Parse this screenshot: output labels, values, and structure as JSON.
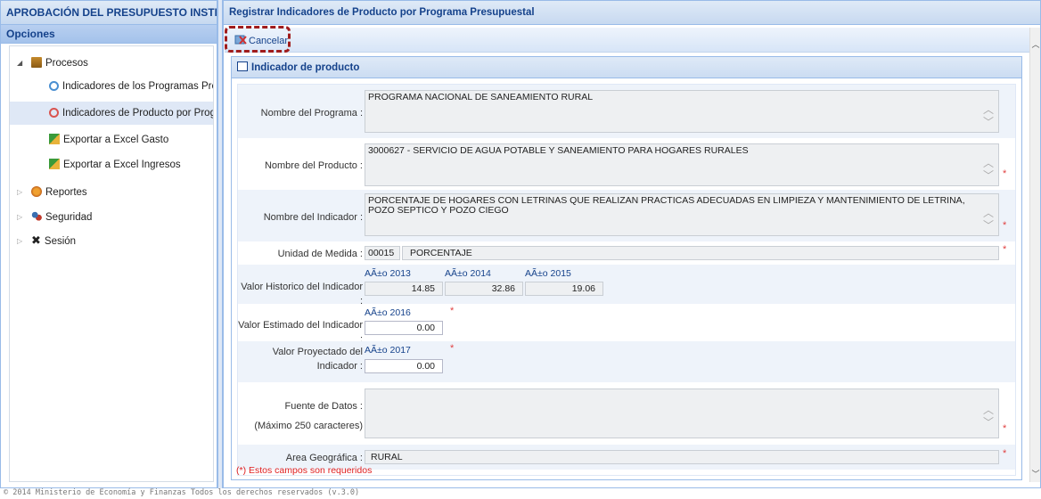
{
  "left_panel": {
    "title": "APROBACIÓN DEL PRESUPUESTO INSTITUCIONA",
    "subtitle": "Opciones",
    "tree": {
      "procesos": "Procesos",
      "indicadores_programas": "Indicadores de los Programas Presupue",
      "indicadores_producto": "Indicadores de Producto por Programa",
      "exportar_gasto": "Exportar a Excel Gasto",
      "exportar_ingresos": "Exportar a Excel Ingresos",
      "reportes": "Reportes",
      "seguridad": "Seguridad",
      "sesion": "Sesión"
    }
  },
  "right_panel": {
    "title": "Registrar Indicadores de Producto por Programa Presupuestal",
    "toolbar": {
      "cancel_label": "Cancelar"
    },
    "fieldset_title": "Indicador de producto",
    "form": {
      "programa_label": "Nombre del Programa :",
      "programa_value": "PROGRAMA NACIONAL DE SANEAMIENTO RURAL",
      "producto_label": "Nombre del Producto :",
      "producto_value": "3000627 - SERVICIO DE AGUA POTABLE Y SANEAMIENTO PARA HOGARES RURALES",
      "indicador_label": "Nombre del Indicador :",
      "indicador_value": "PORCENTAJE DE HOGARES CON LETRINAS QUE REALIZAN PRACTICAS ADECUADAS EN LIMPIEZA Y MANTENIMIENTO DE LETRINA, POZO SEPTICO Y POZO CIEGO",
      "unidad_label": "Unidad de Medida :",
      "unidad_code": "00015",
      "unidad_name": "PORCENTAJE",
      "historico_label": "Valor Historico del Indicador :",
      "historico": [
        {
          "year": "AÃ±o 2013",
          "value": "14.85"
        },
        {
          "year": "AÃ±o 2014",
          "value": "32.86"
        },
        {
          "year": "AÃ±o 2015",
          "value": "19.06"
        }
      ],
      "estimado_label": "Valor Estimado del Indicador :",
      "estimado_year": "AÃ±o 2016",
      "estimado_value": "0.00",
      "proyectado_label_1": "Valor Proyectado del",
      "proyectado_label_2": "Indicador :",
      "proyectado_year": "AÃ±o 2017",
      "proyectado_value": "0.00",
      "fuente_label_1": "Fuente de Datos :",
      "fuente_label_2": "(Máximo 250 caracteres)",
      "fuente_value": "",
      "area_label": "Area Geográfica :",
      "area_value": "RURAL",
      "required_mark": "*",
      "required_note": "(*) Estos campos son requeridos"
    }
  },
  "footer": "© 2014 Ministerio de Economía y Finanzas Todos los derechos reservados (v.3.0)",
  "icons": {
    "tree_collapse": "triangle-down",
    "tree_expand": "triangle-right",
    "scroll_up": "chevron-up",
    "scroll_down": "chevron-down"
  },
  "colors": {
    "header_text": "#15428b",
    "panel_border": "#99bbe8",
    "selected_row": "#dfe8f6",
    "required": "#e04040",
    "cancel_highlight": "#a01c1c"
  }
}
